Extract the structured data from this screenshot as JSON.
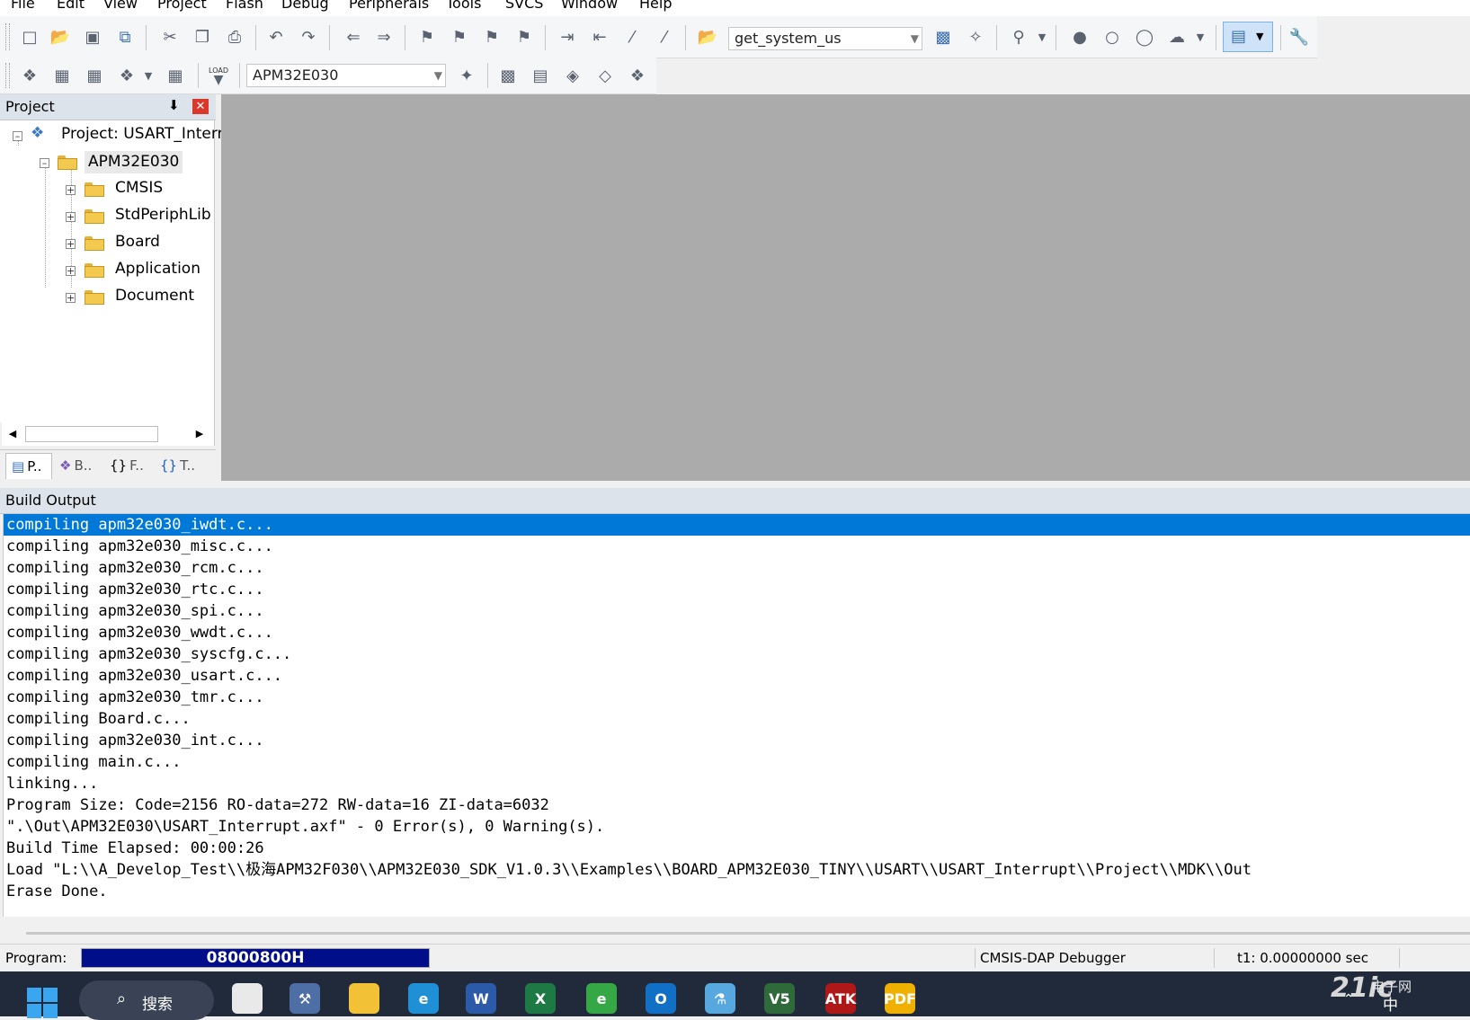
{
  "menu": [
    "File",
    "Edit",
    "View",
    "Project",
    "Flash",
    "Debug",
    "Peripherals",
    "Tools",
    "SVCS",
    "Window",
    "Help"
  ],
  "toolbar": {
    "find_combo": "get_system_us",
    "target_combo": "APM32E030",
    "load_text": "LOAD"
  },
  "project_pane": {
    "title": "Project",
    "pin": "⬇",
    "close": "✕",
    "tree": {
      "root": "Project: USART_Interr",
      "target": "APM32E030",
      "groups": [
        "CMSIS",
        "StdPeriphLib",
        "Board",
        "Application",
        "Document"
      ]
    },
    "tabs": [
      "P..",
      "B..",
      "F..",
      "T.."
    ],
    "tab_glyphs": [
      "▤",
      "❖",
      "{}",
      "{}"
    ]
  },
  "build_output": {
    "title": "Build Output",
    "lines": [
      "compiling apm32e030_iwdt.c...",
      "compiling apm32e030_misc.c...",
      "compiling apm32e030_rcm.c...",
      "compiling apm32e030_rtc.c...",
      "compiling apm32e030_spi.c...",
      "compiling apm32e030_wwdt.c...",
      "compiling apm32e030_syscfg.c...",
      "compiling apm32e030_usart.c...",
      "compiling apm32e030_tmr.c...",
      "compiling Board.c...",
      "compiling apm32e030_int.c...",
      "compiling main.c...",
      "linking...",
      "Program Size: Code=2156 RO-data=272 RW-data=16 ZI-data=6032",
      "\".\\Out\\APM32E030\\USART_Interrupt.axf\" - 0 Error(s), 0 Warning(s).",
      "Build Time Elapsed:  00:00:26",
      "Load \"L:\\\\A_Develop_Test\\\\极海APM32F030\\\\APM32E030_SDK_V1.0.3\\\\Examples\\\\BOARD_APM32E030_TINY\\\\USART\\\\USART_Interrupt\\\\Project\\\\MDK\\\\Out",
      "Erase Done."
    ],
    "selected_index": 0
  },
  "status": {
    "program_label": "Program:",
    "program_value": "08000800H",
    "program_progress": 1.0,
    "debugger": "CMSIS-DAP Debugger",
    "t1": "t1: 0.00000000 sec"
  },
  "taskbar": {
    "search_label": "搜索",
    "search_icon": "⌕",
    "apps": [
      {
        "name": "task-view",
        "label": "",
        "color": "#e9e9e9"
      },
      {
        "name": "keil-installer",
        "label": "⚒",
        "color": "#4d6fa6"
      },
      {
        "name": "file-explorer",
        "label": "",
        "color": "#f3c136"
      },
      {
        "name": "edge",
        "label": "e",
        "color": "#1f8fd6"
      },
      {
        "name": "word",
        "label": "W",
        "color": "#2b5ba8"
      },
      {
        "name": "excel",
        "label": "X",
        "color": "#1e7a44"
      },
      {
        "name": "browser-e",
        "label": "e",
        "color": "#35a845"
      },
      {
        "name": "outlook",
        "label": "O",
        "color": "#1170c6"
      },
      {
        "name": "flask-app",
        "label": "⚗",
        "color": "#58a8e0"
      },
      {
        "name": "keil-uvision",
        "label": "V5",
        "color": "#2f6b3a"
      },
      {
        "name": "atk-xcom",
        "label": "ATK",
        "color": "#b01818"
      },
      {
        "name": "pdf-reader",
        "label": "PDF",
        "color": "#f0b000"
      }
    ],
    "watermark": "21ic",
    "watermark_sub": "电子网",
    "ime": "中",
    "tray_up": "⌃"
  }
}
